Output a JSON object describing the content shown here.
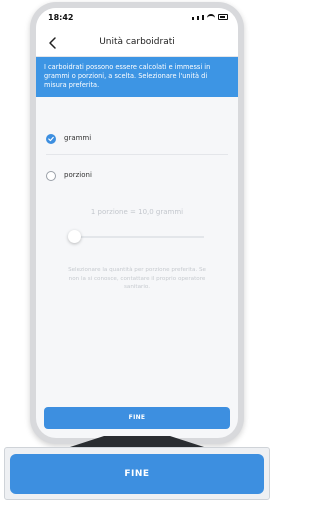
{
  "status_bar": {
    "time": "18:42"
  },
  "nav": {
    "title": "Unità carboidrati"
  },
  "info": {
    "text": "I carboidrati possono essere calcolati e immessi in grammi o porzioni, a scelta. Selezionare l'unità di misura preferita."
  },
  "options": [
    {
      "label": "grammi",
      "selected": true
    },
    {
      "label": "porzioni",
      "selected": false
    }
  ],
  "portion": {
    "conversion_text": "1 porzione = 10,0 grammi",
    "help_text": "Selezionare la quantità per porzione preferita. Se non la si conosce, contattare il proprio operatore sanitario."
  },
  "buttons": {
    "inner_done": "FINE",
    "zoom_done": "FINE"
  },
  "colors": {
    "accent": "#3d8fe0",
    "banner": "#3d95e4"
  },
  "icons": {
    "back": "chevron-left-icon",
    "check": "check-icon"
  }
}
